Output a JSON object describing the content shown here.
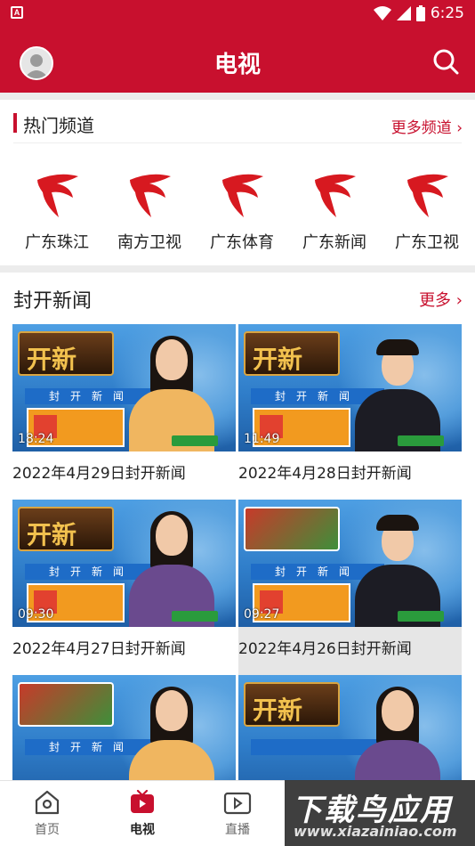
{
  "status_bar": {
    "time": "6:25",
    "app_badge": "A"
  },
  "header": {
    "title": "电视"
  },
  "hot_channels": {
    "title": "热门频道",
    "more_label": "更多频道",
    "channels": [
      {
        "name": "广东珠江"
      },
      {
        "name": "南方卫视"
      },
      {
        "name": "广东体育"
      },
      {
        "name": "广东新闻"
      },
      {
        "name": "广东卫视"
      }
    ]
  },
  "news": {
    "title": "封开新闻",
    "more_label": "更多",
    "items": [
      {
        "title": "2022年4月29日封开新闻",
        "duration": "18:24",
        "logo_text": "开新",
        "banner_text": "封开新闻",
        "anchor": "female-yellow"
      },
      {
        "title": "2022年4月28日封开新闻",
        "duration": "11:49",
        "logo_text": "开新",
        "banner_text": "封开新闻",
        "anchor": "male"
      },
      {
        "title": "2022年4月27日封开新闻",
        "duration": "09:30",
        "logo_text": "开新",
        "banner_text": "封开新闻",
        "anchor": "female-purple"
      },
      {
        "title": "2022年4月26日封开新闻",
        "duration": "09:27",
        "logo_text": "",
        "banner_text": "封开新闻",
        "anchor": "male"
      },
      {
        "title": "",
        "duration": "",
        "logo_text": "",
        "banner_text": "封开新闻",
        "anchor": "female-yellow"
      },
      {
        "title": "",
        "duration": "",
        "logo_text": "开新",
        "banner_text": "",
        "anchor": "female-purple"
      }
    ]
  },
  "bottom_nav": {
    "items": [
      {
        "label": "首页",
        "icon": "home-icon",
        "active": false
      },
      {
        "label": "电视",
        "icon": "tv-icon",
        "active": true
      },
      {
        "label": "直播",
        "icon": "video-icon",
        "active": false
      }
    ]
  },
  "watermark": {
    "main": "下载鸟应用",
    "sub": "www.xiazainiao.com"
  },
  "colors": {
    "brand": "#c8102e"
  }
}
